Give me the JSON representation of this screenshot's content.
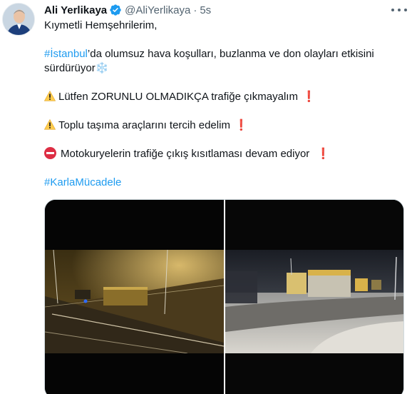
{
  "author": {
    "name": "Ali Yerlikaya",
    "handle": "@AliYerlikaya",
    "separator": "·",
    "time": "5s"
  },
  "tweet": {
    "greeting": "Kıymetli Hemşehrilerim,",
    "line1_hashtag": "#İstanbul",
    "line1_text": "’da olumsuz hava koşulları, buzlanma ve don olayları etkisini",
    "line2_text": "sürdürüyor",
    "line2_emoji": "❄️",
    "warning1": "Lütfen ZORUNLU OLMADIKÇA trafiğe çıkmayalım",
    "warning2": "Toplu taşıma araçlarını tercih edelim",
    "restriction": "Motokuryelerin trafiğe çıkış kısıtlaması devam ediyor",
    "closing_hashtag": "#KarlaMücadele",
    "exclamation": "❗"
  },
  "icons": {
    "verified": "verified-badge-icon",
    "more": "more-options-icon",
    "warning": "warning-icon",
    "no_entry": "no-entry-icon"
  },
  "colors": {
    "link": "#1d9bf0",
    "secondary_text": "#536471",
    "verified": "#1d9bf0"
  }
}
